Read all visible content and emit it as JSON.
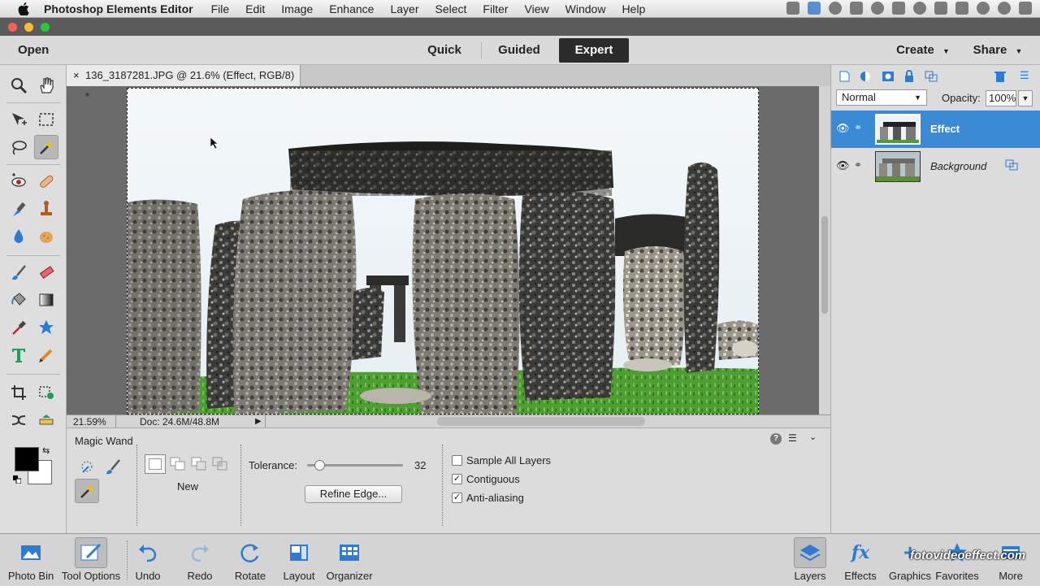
{
  "menubar": {
    "app_name": "Photoshop Elements Editor",
    "items": [
      "File",
      "Edit",
      "Image",
      "Enhance",
      "Layer",
      "Select",
      "Filter",
      "View",
      "Window",
      "Help"
    ]
  },
  "modebar": {
    "open_label": "Open",
    "modes": [
      "Quick",
      "Guided",
      "Expert"
    ],
    "active_mode": "Expert",
    "create_label": "Create",
    "share_label": "Share"
  },
  "document": {
    "tab_title": "136_3187281.JPG @ 21.6% (Effect, RGB/8) *",
    "close_glyph": "×",
    "zoom": "21.59%",
    "doc_info": "Doc: 24.6M/48.8M"
  },
  "tool_options": {
    "tool_name": "Magic Wand",
    "selection_mode_label": "New",
    "tolerance_label": "Tolerance:",
    "tolerance_value": "32",
    "tolerance_fraction": 0.125,
    "refine_edge_label": "Refine Edge...",
    "checkboxes": [
      {
        "label": "Sample All Layers",
        "checked": false
      },
      {
        "label": "Contiguous",
        "checked": true
      },
      {
        "label": "Anti-aliasing",
        "checked": true
      }
    ]
  },
  "layers_panel": {
    "blend_mode": "Normal",
    "opacity_label": "Opacity:",
    "opacity_value": "100%",
    "layers": [
      {
        "name": "Effect",
        "active": true
      },
      {
        "name": "Background",
        "active": false
      }
    ]
  },
  "bottombar": {
    "left_buttons": [
      "Photo Bin",
      "Tool Options",
      "Undo",
      "Redo",
      "Rotate",
      "Layout",
      "Organizer"
    ],
    "right_buttons": [
      "Layers",
      "Effects",
      "Graphics",
      "Favorites",
      "More"
    ],
    "watermark": "fotovideoeffect.com"
  },
  "colors": {
    "accent": "#3b8ad6",
    "active_mode_bg": "#2b2b2b",
    "canvas_sky": "#eef3f6",
    "grass": "#5aa83a"
  }
}
